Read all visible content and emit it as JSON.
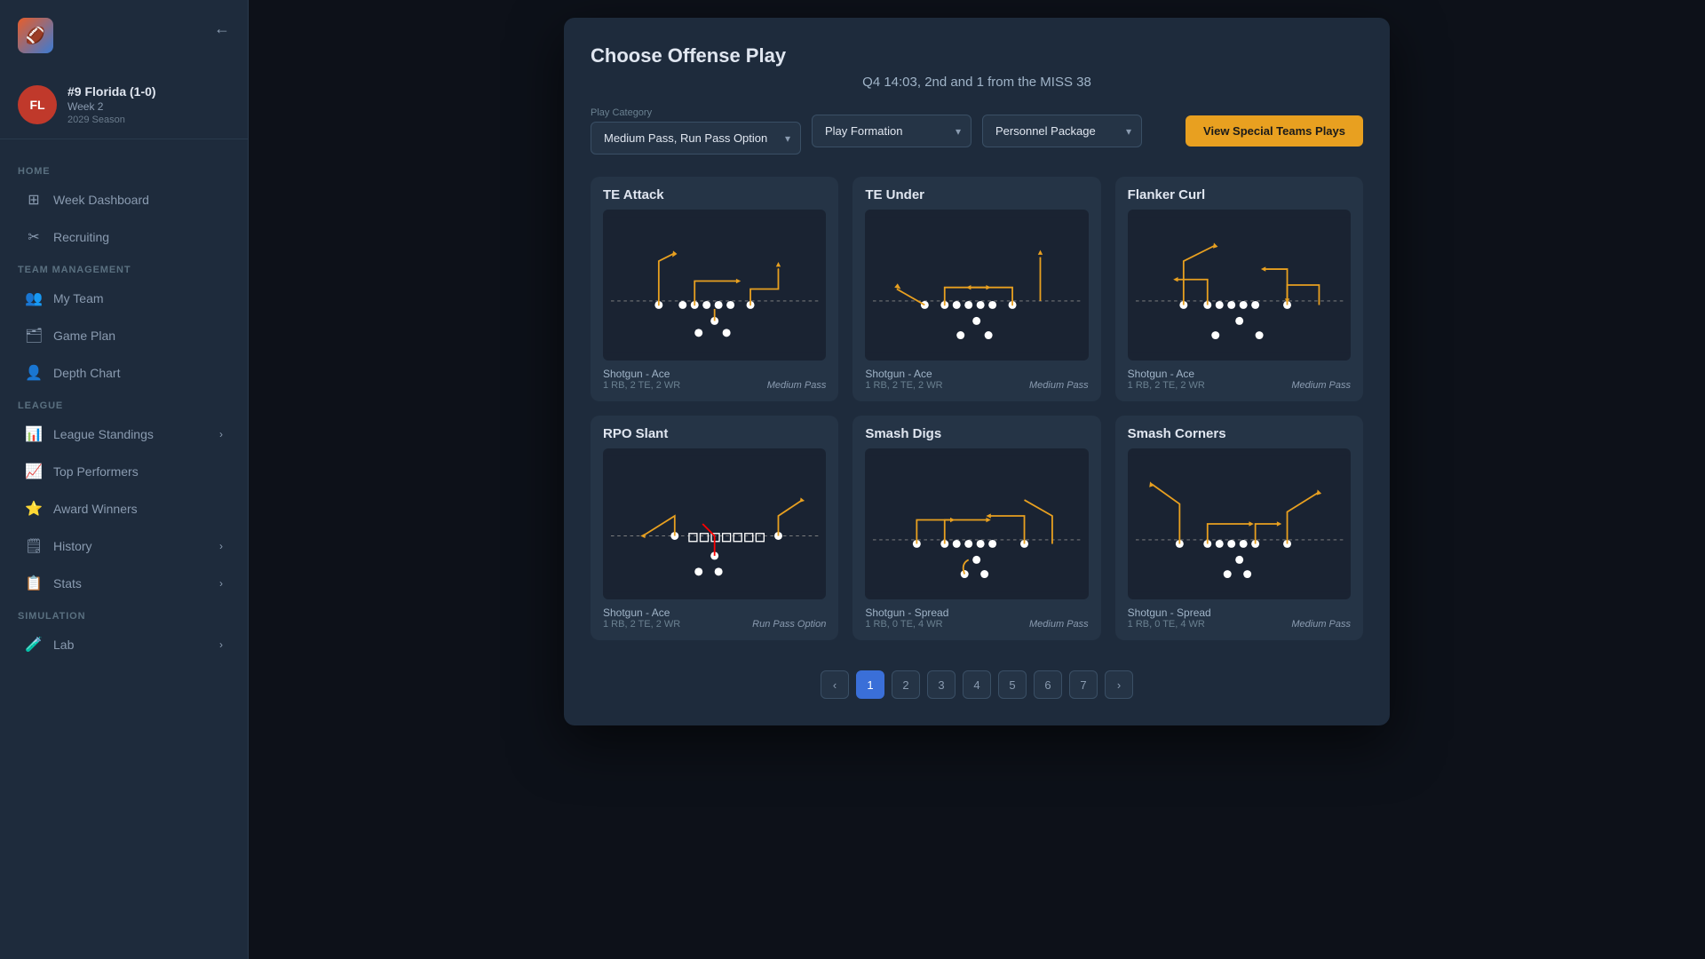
{
  "app": {
    "logo": "🏈"
  },
  "sidebar": {
    "back_button": "←",
    "team": {
      "initials": "FL",
      "name": "#9 Florida (1-0)",
      "week": "Week 2",
      "season": "2029 Season"
    },
    "sections": [
      {
        "label": "HOME",
        "items": [
          {
            "id": "week-dashboard",
            "label": "Week Dashboard",
            "icon": "⊞",
            "has_chevron": false
          },
          {
            "id": "recruiting",
            "label": "Recruiting",
            "icon": "✂",
            "has_chevron": false
          }
        ]
      },
      {
        "label": "TEAM MANAGEMENT",
        "items": [
          {
            "id": "my-team",
            "label": "My Team",
            "icon": "👥",
            "has_chevron": false
          },
          {
            "id": "game-plan",
            "label": "Game Plan",
            "icon": "📋",
            "has_chevron": false
          },
          {
            "id": "depth-chart",
            "label": "Depth Chart",
            "icon": "👤",
            "has_chevron": false
          }
        ]
      },
      {
        "label": "LEAGUE",
        "items": [
          {
            "id": "league-standings",
            "label": "League Standings",
            "icon": "📊",
            "has_chevron": true
          },
          {
            "id": "top-performers",
            "label": "Top Performers",
            "icon": "📈",
            "has_chevron": false
          },
          {
            "id": "award-winners",
            "label": "Award Winners",
            "icon": "⭐",
            "has_chevron": false
          },
          {
            "id": "history",
            "label": "History",
            "icon": "🗒",
            "has_chevron": true
          },
          {
            "id": "stats",
            "label": "Stats",
            "icon": "📋",
            "has_chevron": true
          }
        ]
      },
      {
        "label": "SIMULATION",
        "items": [
          {
            "id": "lab",
            "label": "Lab",
            "icon": "🧪",
            "has_chevron": true
          }
        ]
      }
    ]
  },
  "modal": {
    "title": "Choose Offense Play",
    "subtitle": "Q4 14:03, 2nd and 1 from the MISS 38",
    "controls": {
      "play_category_label": "Play Category",
      "play_category_value": "Medium Pass, Run Pass Option",
      "play_formation_label": "Play Formation",
      "play_formation_placeholder": "Play Formation",
      "personnel_package_label": "Personnel Package",
      "personnel_package_placeholder": "Personnel Package",
      "special_teams_btn": "View Special Teams Plays"
    },
    "plays": [
      {
        "id": "te-attack",
        "title": "TE Attack",
        "formation": "Shotgun - Ace",
        "personnel": "1 RB, 2 TE, 2 WR",
        "type": "Medium Pass",
        "diagram": "te_attack"
      },
      {
        "id": "te-under",
        "title": "TE Under",
        "formation": "Shotgun - Ace",
        "personnel": "1 RB, 2 TE, 2 WR",
        "type": "Medium Pass",
        "diagram": "te_under"
      },
      {
        "id": "flanker-curl",
        "title": "Flanker Curl",
        "formation": "Shotgun - Ace",
        "personnel": "1 RB, 2 TE, 2 WR",
        "type": "Medium Pass",
        "diagram": "flanker_curl"
      },
      {
        "id": "rpo-slant",
        "title": "RPO Slant",
        "formation": "Shotgun - Ace",
        "personnel": "1 RB, 2 TE, 2 WR",
        "type": "Run Pass Option",
        "diagram": "rpo_slant"
      },
      {
        "id": "smash-digs",
        "title": "Smash Digs",
        "formation": "Shotgun - Spread",
        "personnel": "1 RB, 0 TE, 4 WR",
        "type": "Medium Pass",
        "diagram": "smash_digs"
      },
      {
        "id": "smash-corners",
        "title": "Smash Corners",
        "formation": "Shotgun - Spread",
        "personnel": "1 RB, 0 TE, 4 WR",
        "type": "Medium Pass",
        "diagram": "smash_corners"
      }
    ],
    "pagination": {
      "current": 1,
      "total": 7,
      "prev": "‹",
      "next": "›",
      "pages": [
        1,
        2,
        3,
        4,
        5,
        6,
        7
      ]
    }
  }
}
